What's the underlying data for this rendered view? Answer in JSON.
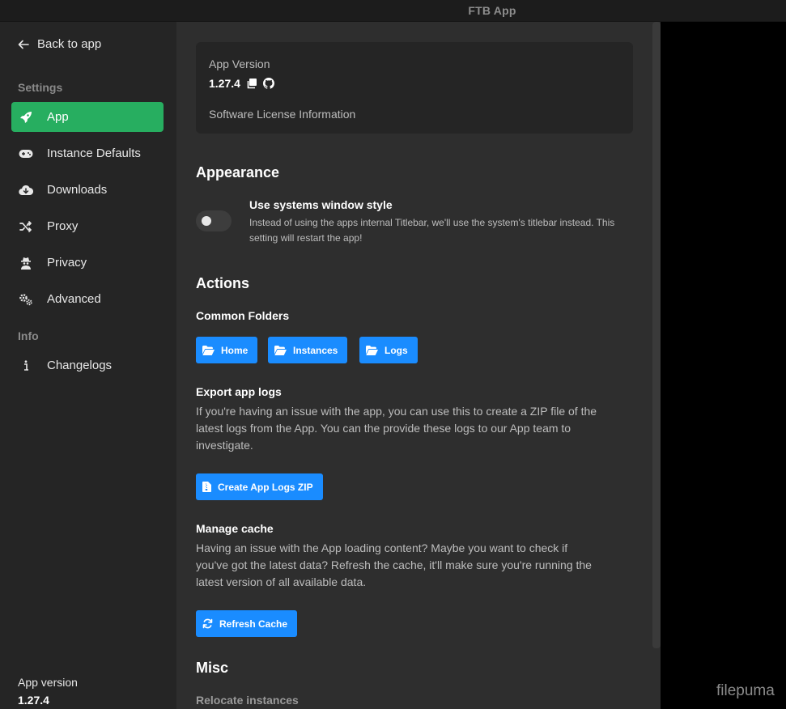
{
  "window": {
    "title": "FTB App"
  },
  "sidebar": {
    "back_label": "Back to app",
    "settings_heading": "Settings",
    "info_heading": "Info",
    "items": [
      {
        "label": "App",
        "icon": "rocket-icon"
      },
      {
        "label": "Instance Defaults",
        "icon": "gamepad-icon"
      },
      {
        "label": "Downloads",
        "icon": "cloud-download-icon"
      },
      {
        "label": "Proxy",
        "icon": "shuffle-icon"
      },
      {
        "label": "Privacy",
        "icon": "user-secret-icon"
      },
      {
        "label": "Advanced",
        "icon": "gears-icon"
      }
    ],
    "info_items": [
      {
        "label": "Changelogs",
        "icon": "info-icon"
      }
    ],
    "footer": {
      "label": "App version",
      "value": "1.27.4"
    }
  },
  "main": {
    "version_card": {
      "label": "App Version",
      "version": "1.27.4",
      "license_link": "Software License Information"
    },
    "appearance": {
      "heading": "Appearance",
      "toggle_title": "Use systems window style",
      "toggle_desc": "Instead of using the apps internal Titlebar, we'll use the system's titlebar instead. This setting will restart the app!",
      "toggle_on": false
    },
    "actions": {
      "heading": "Actions",
      "common_folders": {
        "heading": "Common Folders",
        "buttons": [
          "Home",
          "Instances",
          "Logs"
        ]
      },
      "export_logs": {
        "heading": "Export app logs",
        "desc": "If you're having an issue with the app, you can use this to create a ZIP file of the latest logs from the App. You can the provide these logs to our App team to investigate.",
        "button": "Create App Logs ZIP"
      },
      "manage_cache": {
        "heading": "Manage cache",
        "desc": "Having an issue with the App loading content? Maybe you want to check if you've got the latest data? Refresh the cache, it'll make sure you're running the latest version of all available data.",
        "button": "Refresh Cache"
      }
    },
    "misc": {
      "heading": "Misc",
      "relocate_heading": "Relocate instances"
    }
  },
  "colors": {
    "accent_green": "#27ae60",
    "button_blue": "#1a8cff"
  },
  "watermark": "filepuma"
}
